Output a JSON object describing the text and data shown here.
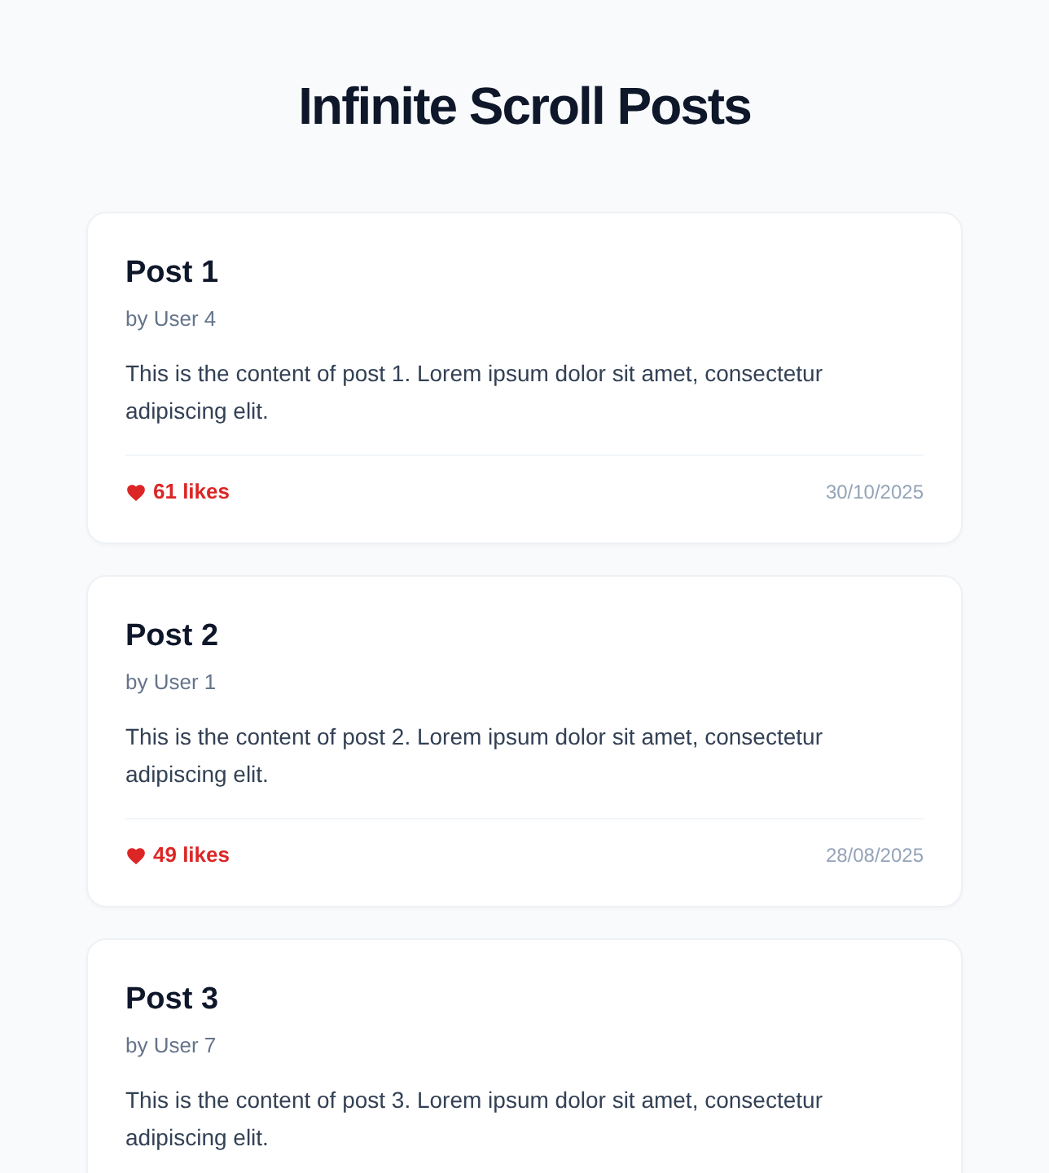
{
  "page": {
    "title": "Infinite Scroll Posts"
  },
  "posts": [
    {
      "title": "Post 1",
      "author": "by User 4",
      "content": "This is the content of post 1. Lorem ipsum dolor sit amet, consectetur adipiscing elit.",
      "likes": "61 likes",
      "date": "30/10/2025"
    },
    {
      "title": "Post 2",
      "author": "by User 1",
      "content": "This is the content of post 2. Lorem ipsum dolor sit amet, consectetur adipiscing elit.",
      "likes": "49 likes",
      "date": "28/08/2025"
    },
    {
      "title": "Post 3",
      "author": "by User 7",
      "content": "This is the content of post 3. Lorem ipsum dolor sit amet, consectetur adipiscing elit."
    }
  ]
}
